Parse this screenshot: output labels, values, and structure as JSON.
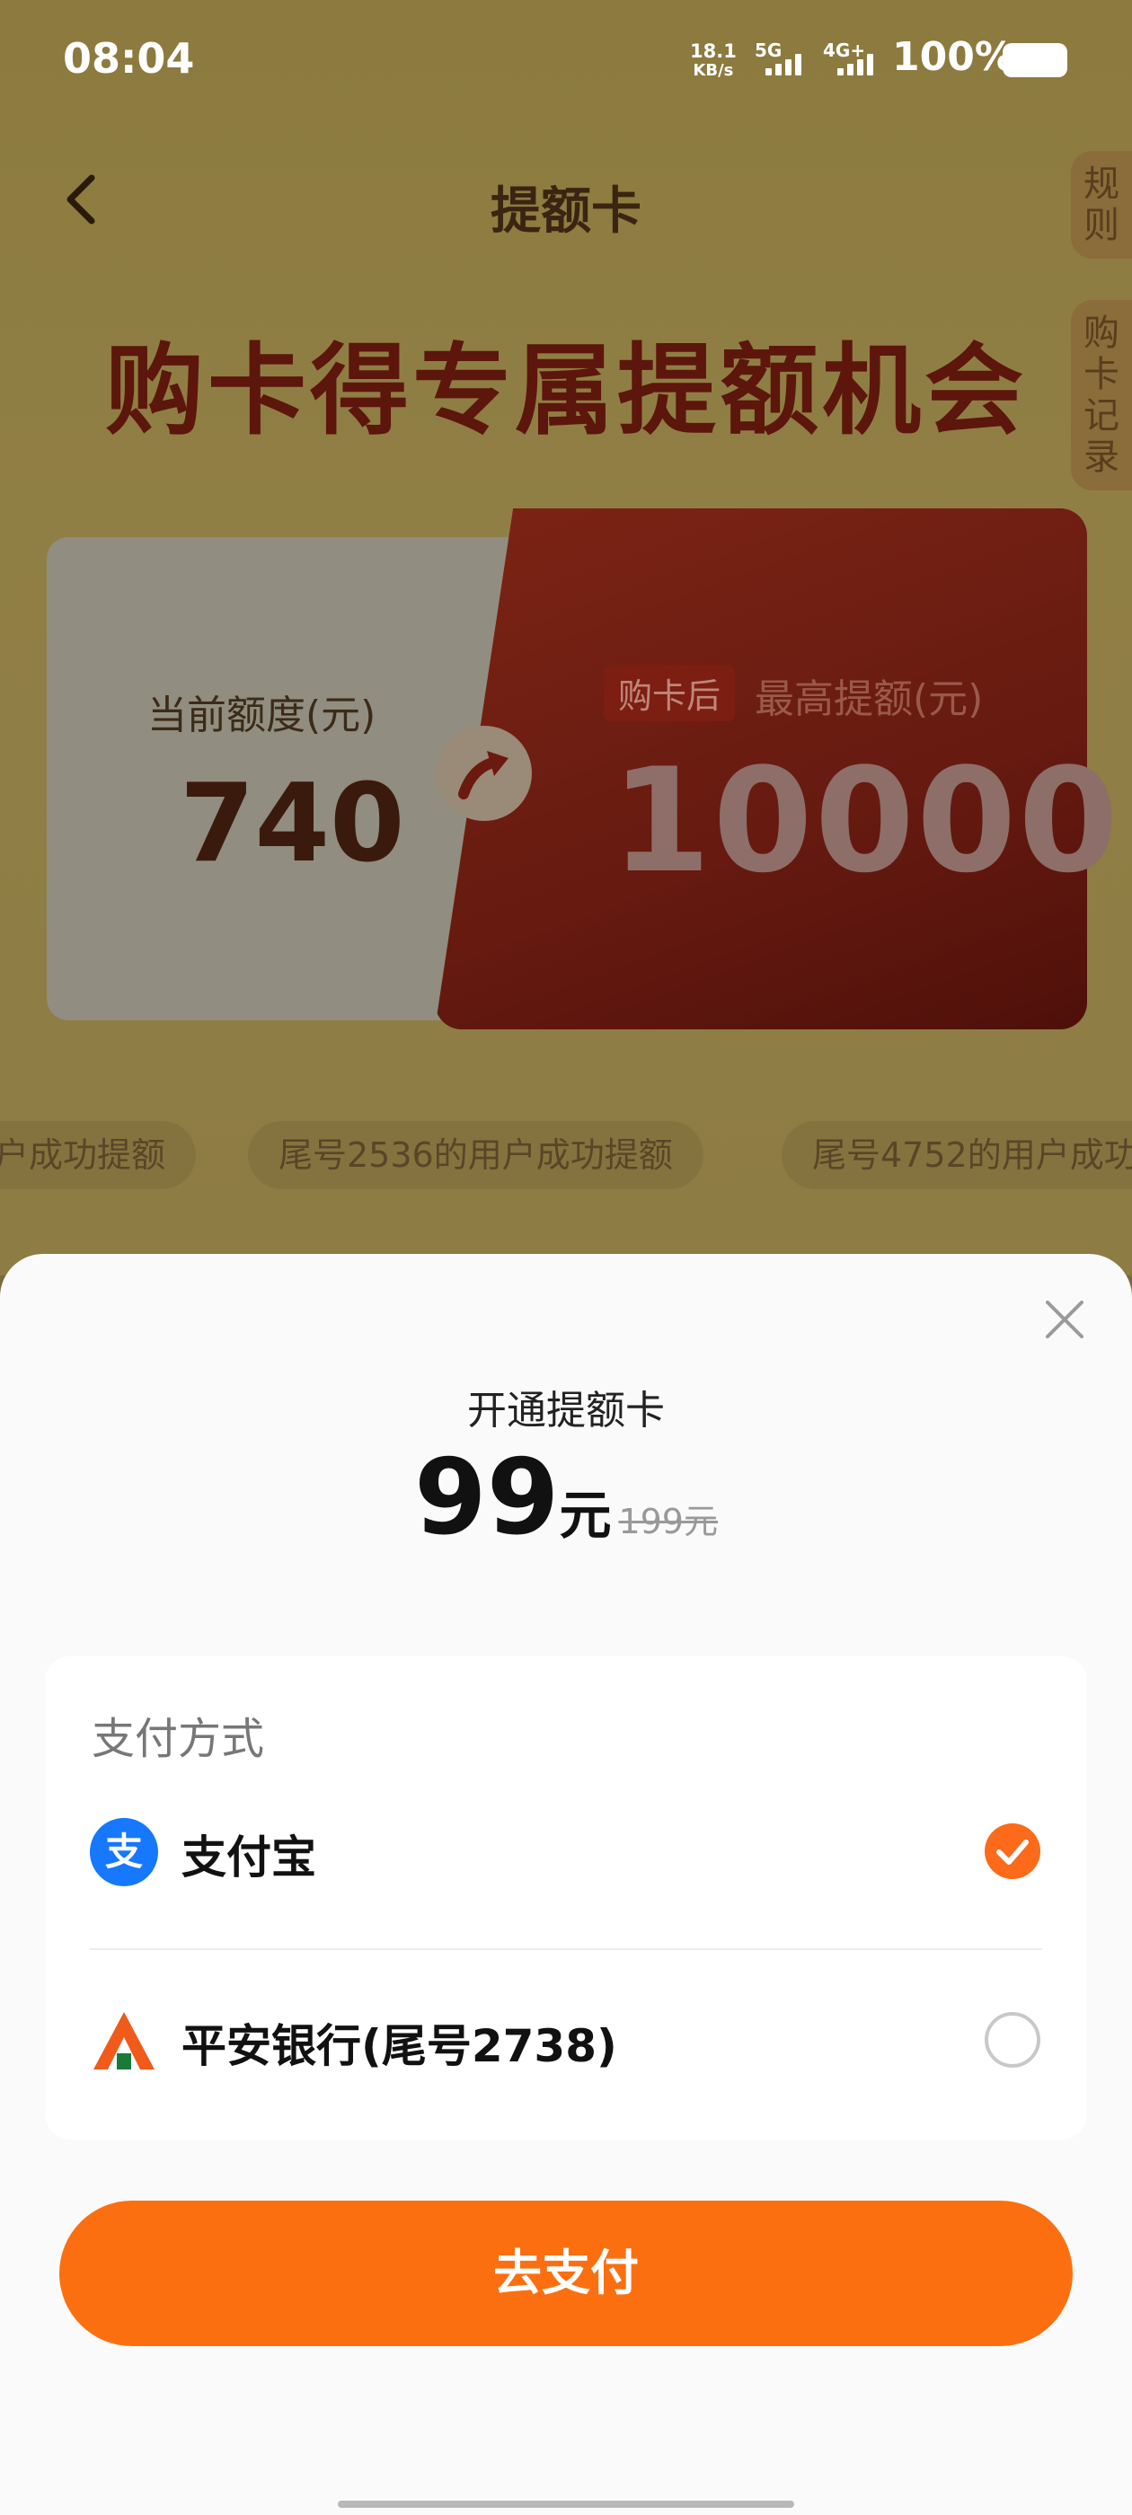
{
  "status_bar": {
    "time": "08:04",
    "net_speed": "18.1",
    "net_unit": "KB/s",
    "sig1": "5G",
    "sig2": "4G+",
    "battery": "100%"
  },
  "nav": {
    "title": "提额卡",
    "side_tabs": [
      "规则",
      "购卡记录"
    ]
  },
  "hero": {
    "headline": "购卡得专属提额机会",
    "current_label": "当前额度(元)",
    "current_value": "740",
    "badge": "购卡后",
    "max_label": "最高提额(元)",
    "max_value": "10000"
  },
  "tickers": [
    "户成功提额",
    "尾号2536的用户成功提额",
    "尾号4752的用户成功"
  ],
  "sheet": {
    "title": "开通提额卡",
    "price": "99",
    "unit": "元",
    "original_price": "199元",
    "pay_heading": "支付方式",
    "methods": [
      {
        "label": "支付宝",
        "icon": "alipay-icon",
        "selected": true
      },
      {
        "label": "平安银行(尾号2738)",
        "icon": "pingan-bank-icon",
        "selected": false
      }
    ],
    "pay_button": "去支付"
  },
  "colors": {
    "accent": "#fc6f10",
    "alipay_blue": "#1677ff",
    "pingan_orange": "#f05a1a"
  }
}
